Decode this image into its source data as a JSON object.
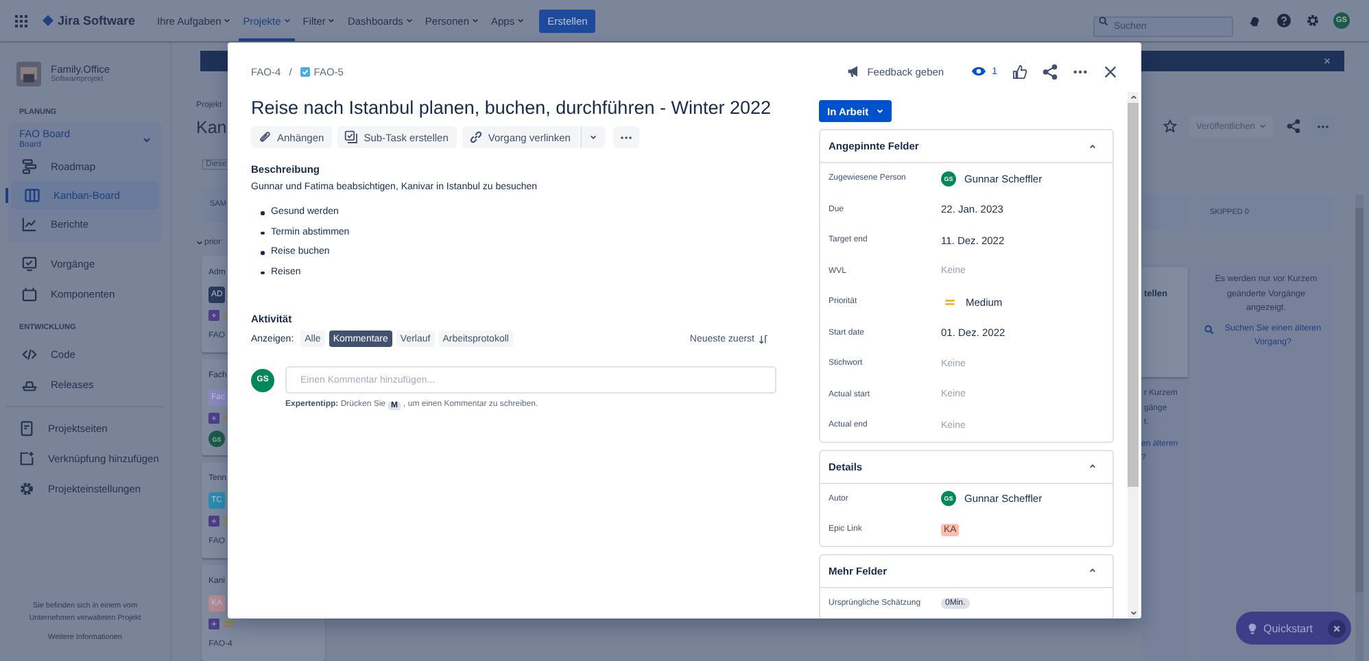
{
  "top_nav": {
    "logo": "Jira Software",
    "menus": [
      {
        "label": "Ihre Aufgaben",
        "selected": false
      },
      {
        "label": "Projekte",
        "selected": true
      },
      {
        "label": "Filter",
        "selected": false
      },
      {
        "label": "Dashboards",
        "selected": false
      },
      {
        "label": "Personen",
        "selected": false
      },
      {
        "label": "Apps",
        "selected": false
      }
    ],
    "create_button": "Erstellen",
    "search": {
      "placeholder": "Suchen"
    },
    "avatar": "GS"
  },
  "sidebar": {
    "project": {
      "name": "Family.Office",
      "type": "Softwareprojekt"
    },
    "groups": [
      {
        "heading": "PLANUNG",
        "board": {
          "name": "FAO Board",
          "type": "Board"
        },
        "items": [
          {
            "label": "Roadmap",
            "kind": "roadmap",
            "selected": false
          },
          {
            "label": "Kanban-Board",
            "kind": "board",
            "selected": true
          },
          {
            "label": "Berichte",
            "kind": "reports",
            "selected": false
          }
        ]
      },
      {
        "items": [
          {
            "label": "Vorgänge",
            "kind": "issues",
            "selected": false
          },
          {
            "label": "Komponenten",
            "kind": "components",
            "selected": false
          }
        ]
      },
      {
        "heading": "ENTWICKLUNG",
        "items": [
          {
            "label": "Code",
            "kind": "code",
            "selected": false
          },
          {
            "label": "Releases",
            "kind": "releases",
            "selected": false
          }
        ]
      },
      {
        "items": [
          {
            "label": "Projektseiten",
            "kind": "pages",
            "selected": false
          },
          {
            "label": "Verknüpfung hinzufügen",
            "kind": "shortcut",
            "selected": false
          },
          {
            "label": "Projekteinstellungen",
            "kind": "settings",
            "selected": false
          }
        ]
      }
    ],
    "notice": "Sie befinden sich in einem vom Unternehmen verwalteten Projekt",
    "notice_link": "Weitere Informationen"
  },
  "board_behind": {
    "breadcrumb": "Projekt",
    "title": "Kan",
    "filter_placeholder": "Diese",
    "column": "SAM",
    "swimlane": "prior",
    "cards": [
      {
        "title": "Adm",
        "tag": "AD",
        "color": "#2c3a5c",
        "key": "FAO"
      },
      {
        "title": "Fach",
        "tag": "Fac",
        "color": "#8c88bd",
        "avatar": "GS"
      },
      {
        "title": "Tenn",
        "tag": "TC",
        "color": "#2a8cb0",
        "key": "FAO"
      },
      {
        "title": "Kani",
        "tag": "KA",
        "color": "#b88a95",
        "key": "FAO-4"
      }
    ],
    "publish_button": "Veröffentlichen",
    "partial_column": {
      "card_text": "tellen",
      "notice_lines": [
        "r Kurzem",
        "gänge",
        "t."
      ],
      "link_lines": [
        "en älteren",
        "?"
      ]
    },
    "skipped_column": {
      "header": "SKIPPED 0",
      "notice": "Es werden nur vor Kurzem geänderte Vorgänge angezeigt.",
      "search_link": "Suchen Sie einen älteren Vorgang?"
    }
  },
  "quickstart": "Quickstart",
  "issue_dialog": {
    "parent_key": "FAO-4",
    "separator": "/",
    "key": "FAO-5",
    "feedback": "Feedback geben",
    "watchers": "1",
    "title": "Reise nach Istanbul planen, buchen, durchführen - Winter 2022",
    "actions": [
      {
        "label": "Anhängen",
        "kind": "attach"
      },
      {
        "label": "Sub-Task erstellen",
        "kind": "subtask"
      },
      {
        "label": "Vorgang verlinken",
        "kind": "link"
      }
    ],
    "description": {
      "heading": "Beschreibung",
      "text": "Gunnar und Fatima beabsichtigen, Kanivar in Istanbul zu besuchen",
      "bullets": [
        "Gesund werden",
        "Termin abstimmen",
        "Reise buchen",
        "Reisen"
      ]
    },
    "activity": {
      "heading": "Aktivität",
      "show_label": "Anzeigen:",
      "filters": [
        {
          "label": "Alle",
          "selected": false
        },
        {
          "label": "Kommentare",
          "selected": true
        },
        {
          "label": "Verlauf",
          "selected": false
        },
        {
          "label": "Arbeitsprotokoll",
          "selected": false
        }
      ],
      "sort": "Neueste zuerst",
      "comment": {
        "avatar": "GS",
        "placeholder": "Einen Kommentar hinzufügen..."
      },
      "tip": {
        "before": "**Expertentipp:** Drücken Sie",
        "key": "M",
        "after": ", um einen Kommentar zu schreiben."
      }
    },
    "status": "In Arbeit",
    "panels": [
      {
        "title": "Angepinnte Felder",
        "expanded": true,
        "fields": [
          {
            "label": "Zugewiesene Person",
            "kind": "user",
            "avatar": "GS",
            "value": "Gunnar Scheffler"
          },
          {
            "label": "Due",
            "kind": "text",
            "value": "22. Jan. 2023"
          },
          {
            "label": "Target end",
            "kind": "text",
            "value": "11. Dez. 2022"
          },
          {
            "label": "WVL",
            "kind": "empty",
            "value": "Keine"
          },
          {
            "label": "Priorität",
            "kind": "priority",
            "value": "Medium"
          },
          {
            "label": "Start date",
            "kind": "text",
            "value": "01. Dez. 2022"
          },
          {
            "label": "Stichwort",
            "kind": "empty",
            "value": "Keine"
          },
          {
            "label": "Actual start",
            "kind": "empty",
            "value": "Keine"
          },
          {
            "label": "Actual end",
            "kind": "empty",
            "value": "Keine"
          }
        ]
      },
      {
        "title": "Details",
        "expanded": true,
        "fields": [
          {
            "label": "Autor",
            "kind": "user",
            "avatar": "GS",
            "value": "Gunnar Scheffler"
          },
          {
            "label": "Epic Link",
            "kind": "tag",
            "value": "KA"
          }
        ]
      },
      {
        "title": "Mehr Felder",
        "expanded": true,
        "fields": [
          {
            "label": "Ursprüngliche Schätzung",
            "kind": "time",
            "value": "0Min."
          }
        ]
      }
    ]
  }
}
